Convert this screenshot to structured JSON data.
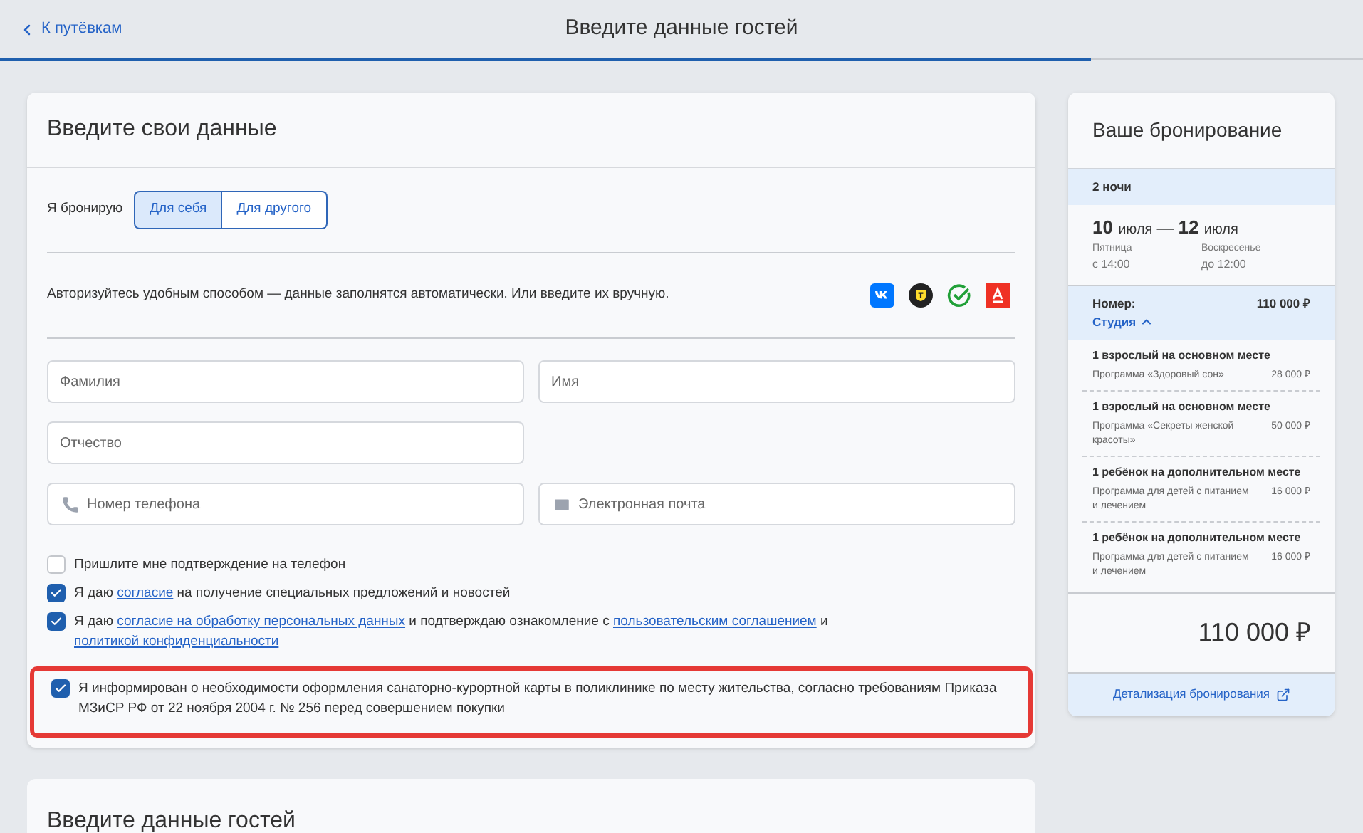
{
  "header": {
    "back_link": "К путёвкам",
    "title": "Введите данные гостей",
    "progress": {
      "level": 0.8
    }
  },
  "own_data": {
    "title": "Введите свои данные",
    "booking_for": {
      "label": "Я бронирую",
      "options": [
        {
          "label": "Для себя",
          "selected": true
        },
        {
          "label": "Для другого",
          "selected": false
        }
      ]
    },
    "auth_hint": "Авторизуйтесь удобным способом — данные заполнятся автоматически. Или введите их вручную.",
    "auth_methods": [
      {
        "kind": "vk"
      },
      {
        "kind": "tinkoff"
      },
      {
        "kind": "sber"
      },
      {
        "kind": "alfa"
      }
    ],
    "fields": [
      {
        "placeholder": "Фамилия",
        "kind": "plain"
      },
      {
        "placeholder": "Имя",
        "kind": "plain"
      },
      {
        "placeholder": "Отчество",
        "kind": "plain"
      },
      {
        "placeholder": "Номер телефона",
        "kind": "phone"
      },
      {
        "placeholder": "Электронная почта",
        "kind": "email"
      }
    ],
    "checkboxes": [
      {
        "checked": false,
        "highlighted": false,
        "parts": [
          {
            "text": "Пришлите мне подтверждение на телефон",
            "link": false
          }
        ]
      },
      {
        "checked": true,
        "highlighted": false,
        "parts": [
          {
            "text": "Я даю ",
            "link": false
          },
          {
            "text": "согласие",
            "link": true
          },
          {
            "text": " на получение специальных предложений и новостей",
            "link": false
          }
        ]
      },
      {
        "checked": true,
        "highlighted": false,
        "parts": [
          {
            "text": "Я даю ",
            "link": false
          },
          {
            "text": "согласие на обработку персональных данных",
            "link": true
          },
          {
            "text": " и подтверждаю ознакомление с ",
            "link": false
          },
          {
            "text": "пользовательским соглашением",
            "link": true
          },
          {
            "text": " и ",
            "link": false
          },
          {
            "text": "политикой конфиденциальности",
            "link": true
          }
        ]
      },
      {
        "checked": true,
        "highlighted": true,
        "parts": [
          {
            "text": "Я информирован о необходимости оформления санаторно-курортной карты в поликлинике по месту жительства, согласно требованиям Приказа МЗиСР РФ от 22 ноября 2004 г. № 256 перед совершением покупки",
            "link": false
          }
        ]
      }
    ]
  },
  "guests": {
    "title": "Введите данные гостей"
  },
  "booking": {
    "title": "Ваше бронирование",
    "nights": "2 ночи",
    "checkin": {
      "day": "10",
      "month": "июля",
      "weekday": "Пятница",
      "time": "с 14:00"
    },
    "dash": "—",
    "checkout": {
      "day": "12",
      "month": "июля",
      "weekday": "Воскресенье",
      "time": "до 12:00"
    },
    "room": {
      "label": "Номер:",
      "price": "110 000 ₽",
      "type": "Студия",
      "expanded": true
    },
    "guests": [
      {
        "title": "1 взрослый на основном месте",
        "program": "Программа «Здоровый сон»",
        "price": "28 000 ₽"
      },
      {
        "title": "1 взрослый на основном месте",
        "program": "Программа «Секреты женской красоты»",
        "price": "50 000 ₽"
      },
      {
        "title": "1 ребёнок на дополнительном месте",
        "program": "Программа для детей с питанием и лечением",
        "price": "16 000 ₽"
      },
      {
        "title": "1 ребёнок на дополнительном месте",
        "program": "Программа для детей с питанием и лечением",
        "price": "16 000 ₽"
      }
    ],
    "total": "110 000 ₽",
    "details_link": "Детализация бронирования"
  }
}
